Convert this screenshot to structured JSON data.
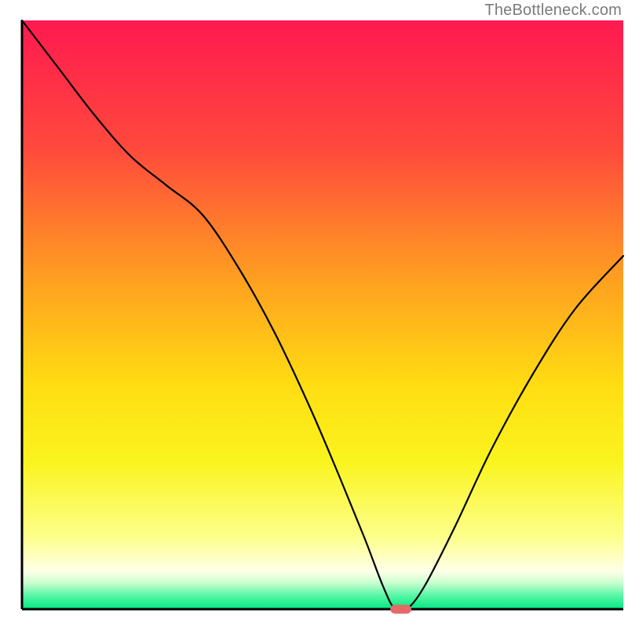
{
  "watermark": "TheBottleneck.com",
  "chart_data": {
    "type": "line",
    "title": "",
    "xlabel": "",
    "ylabel": "",
    "xlim": [
      0,
      100
    ],
    "ylim": [
      0,
      100
    ],
    "background": {
      "type": "vertical-gradient",
      "stops": [
        {
          "offset": 0.0,
          "color": "#ff1950"
        },
        {
          "offset": 0.22,
          "color": "#ff4a3c"
        },
        {
          "offset": 0.45,
          "color": "#ffa31f"
        },
        {
          "offset": 0.62,
          "color": "#ffdd12"
        },
        {
          "offset": 0.75,
          "color": "#faf41e"
        },
        {
          "offset": 0.88,
          "color": "#fdff8e"
        },
        {
          "offset": 0.935,
          "color": "#ffffe8"
        },
        {
          "offset": 0.955,
          "color": "#caffd0"
        },
        {
          "offset": 0.975,
          "color": "#60f7a8"
        },
        {
          "offset": 1.0,
          "color": "#00e884"
        }
      ]
    },
    "series": [
      {
        "name": "bottleneck-curve",
        "color": "#000000",
        "note": "Percent bottleneck vs an unlabeled x-axis. Minimum near x≈62.",
        "x": [
          0,
          6,
          12,
          18,
          24,
          30,
          36,
          42,
          48,
          53,
          57,
          60,
          62,
          64,
          67,
          72,
          78,
          85,
          92,
          100
        ],
        "y": [
          100,
          92,
          84,
          77,
          72,
          67,
          58,
          47,
          34,
          22,
          12,
          4,
          0,
          0,
          4,
          14,
          27,
          40,
          51,
          60
        ]
      }
    ],
    "marker": {
      "name": "optimal-point",
      "shape": "rounded-rect",
      "color": "#e46a6a",
      "cx": 63,
      "cy": 0,
      "w": 3.5,
      "h": 1.5
    },
    "axes": {
      "draw_ticks": false,
      "draw_labels": false,
      "left_border": true,
      "bottom_border": true
    }
  }
}
